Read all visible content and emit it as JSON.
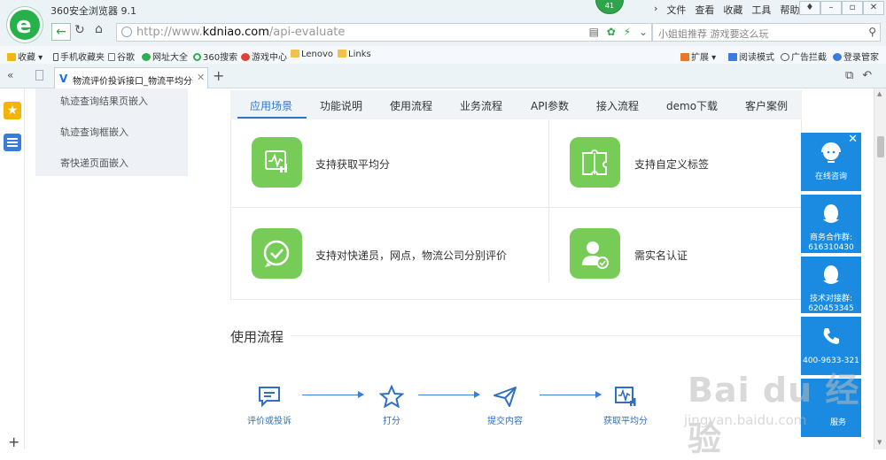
{
  "browser": {
    "app_title": "360安全浏览器 9.1",
    "badge_count": "41",
    "menu": [
      "文件",
      "查看",
      "收藏",
      "工具",
      "帮助"
    ],
    "url_prefix": "http://www.",
    "url_domain": "kdniao.com",
    "url_path": "/api-evaluate",
    "search_placeholder": "小姐姐推荐 游戏要这么玩",
    "bookmarks": [
      "收藏",
      "手机收藏夹",
      "谷歌",
      "网址大全",
      "360搜索",
      "游戏中心",
      "Lenovo",
      "Links"
    ],
    "bookmark_right": [
      "扩展",
      "阅读模式",
      "广告拦截",
      "登录管家"
    ],
    "tab_title": "物流评价投诉接口_物流平均分获"
  },
  "page": {
    "side_menu": [
      "轨迹查询结果页嵌入",
      "轨迹查询框嵌入",
      "寄快递页面嵌入"
    ],
    "tabs": [
      "应用场景",
      "功能说明",
      "使用流程",
      "业务流程",
      "API参数",
      "接入流程",
      "demo下载",
      "客户案例"
    ],
    "features": [
      {
        "text": "支持获取平均分",
        "icon": "chart-icon"
      },
      {
        "text": "支持自定义标签",
        "icon": "puzzle-icon"
      },
      {
        "text": "支持对快递员，网点，物流公司分别评价",
        "icon": "check-bubble-icon"
      },
      {
        "text": "需实名认证",
        "icon": "verified-user-icon"
      }
    ],
    "flow_title": "使用流程",
    "flow_steps": [
      "评价或投诉",
      "打分",
      "提交内容",
      "获取平均分"
    ]
  },
  "service_panel": {
    "online": "在线咨询",
    "biz_group": "商务合作群:",
    "biz_number": "616310430",
    "tech_group": "技术对接群:",
    "tech_number": "620453345",
    "phone": "400-9633-321",
    "bottom": "服务"
  },
  "watermark": {
    "text": "Bai du 经验",
    "url": "jingyan.baidu.com"
  },
  "colors": {
    "accent_blue": "#2e77c8",
    "feature_green": "#76cc57",
    "service_blue": "#1a8be0"
  }
}
